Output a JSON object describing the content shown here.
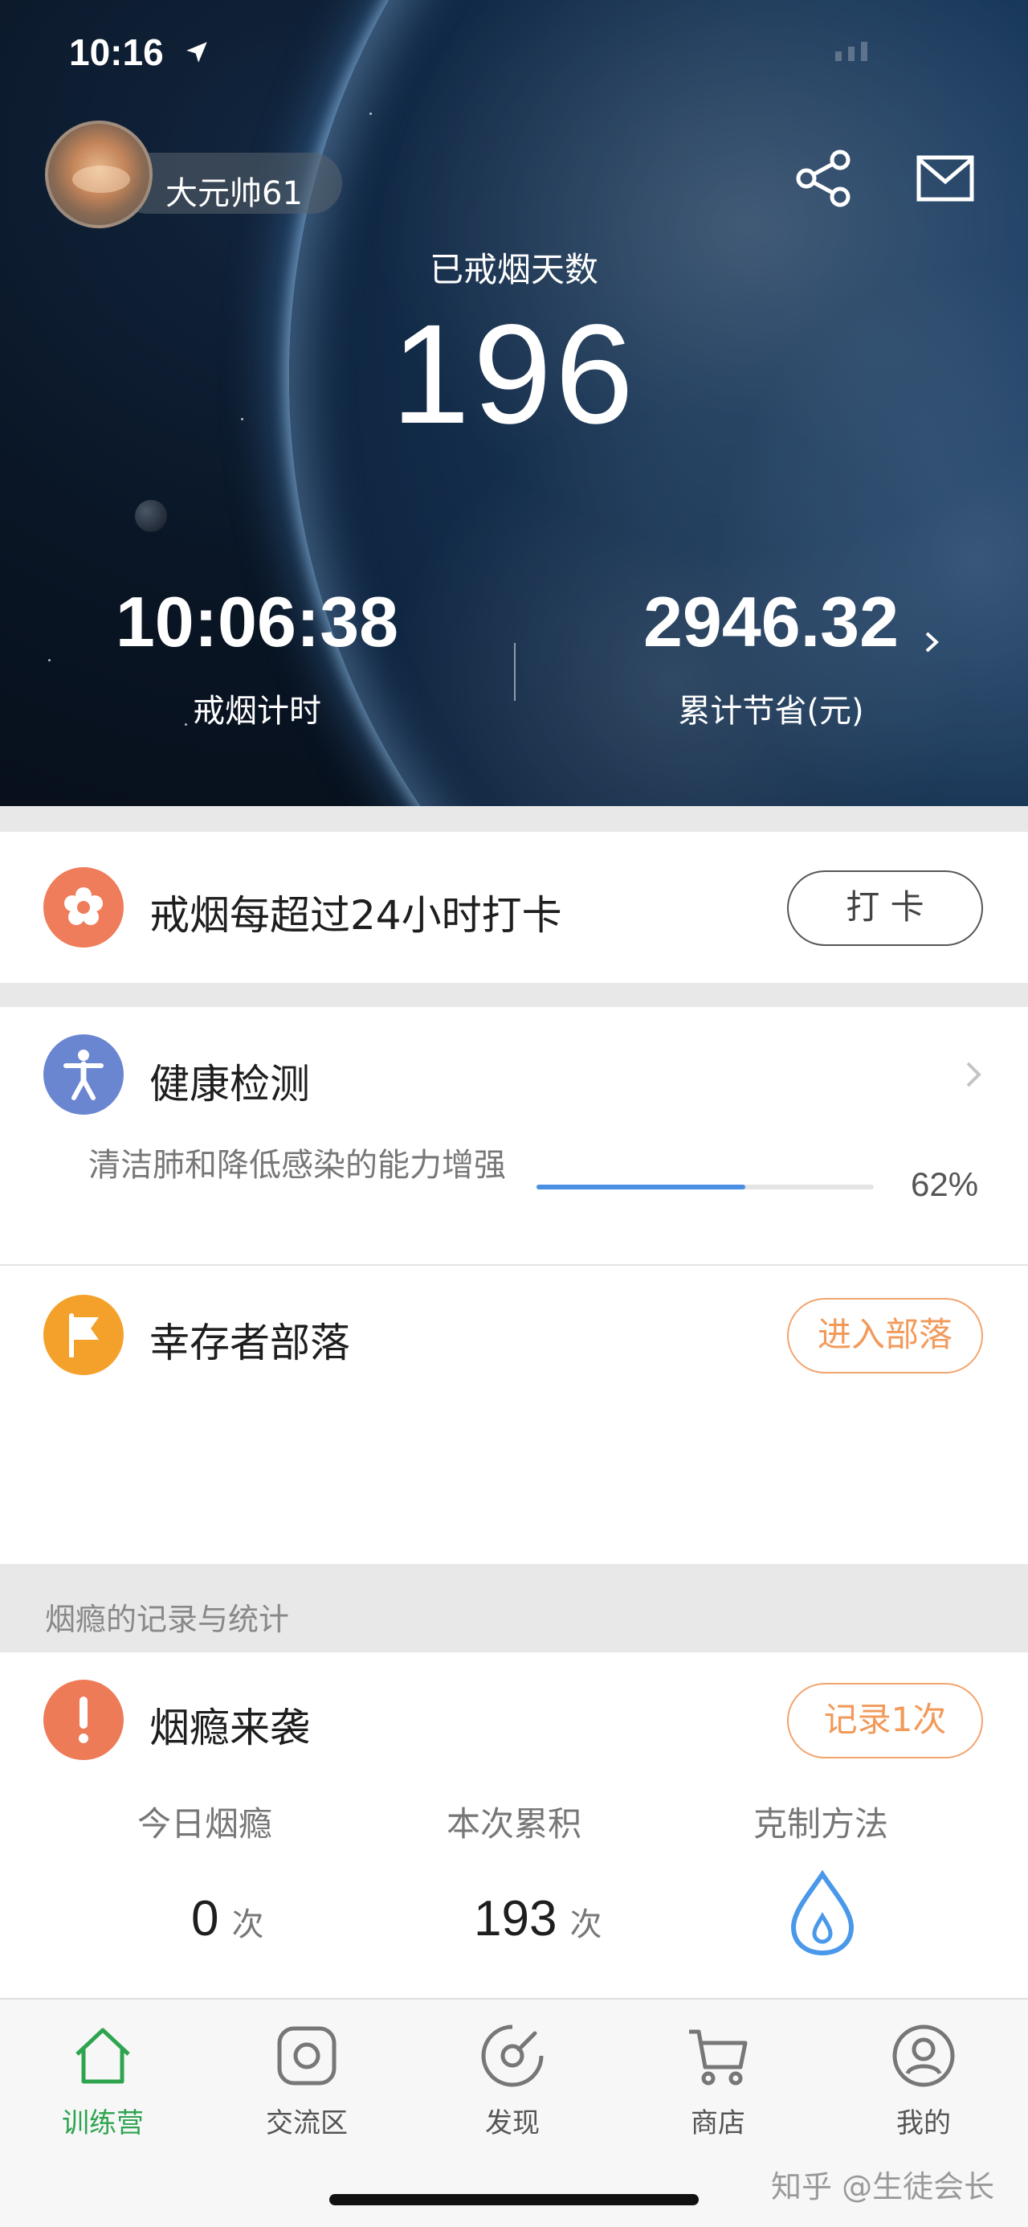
{
  "status_bar": {
    "time": "10:16"
  },
  "profile": {
    "username": "大元帅61"
  },
  "hero": {
    "quit_days_label": "已戒烟天数",
    "quit_days_value": "196",
    "timer_value": "10:06:38",
    "timer_label": "戒烟计时",
    "saved_value": "2946.32",
    "saved_label": "累计节省(元)"
  },
  "checkin": {
    "title": "戒烟每超过24小时打卡",
    "button_label": "打 卡",
    "icon": "flower-icon",
    "color": "#ef7c5a"
  },
  "health": {
    "title": "健康检测",
    "icon": "person-icon",
    "color": "#6b86d1",
    "description": "清洁肺和降低感染的能力增强",
    "progress_percent": 62,
    "progress_text": "62%"
  },
  "tribe": {
    "title": "幸存者部落",
    "button_label": "进入部落",
    "icon": "flag-icon",
    "color": "#f4a12c"
  },
  "stats_section": {
    "header": "烟瘾的记录与统计"
  },
  "craving": {
    "title": "烟瘾来袭",
    "icon": "exclamation-icon",
    "color": "#ee7b58",
    "button_label": "记录1次",
    "columns": {
      "today_label": "今日烟瘾",
      "today_value": "0",
      "today_unit": "次",
      "cumulative_label": "本次累积",
      "cumulative_value": "193",
      "cumulative_unit": "次",
      "method_label": "克制方法"
    }
  },
  "tabbar": {
    "items": [
      {
        "label": "训练营",
        "icon": "house-icon",
        "active": true
      },
      {
        "label": "交流区",
        "icon": "chat-square-icon",
        "active": false
      },
      {
        "label": "发现",
        "icon": "compass-icon",
        "active": false
      },
      {
        "label": "商店",
        "icon": "cart-icon",
        "active": false
      },
      {
        "label": "我的",
        "icon": "user-circle-icon",
        "active": false
      }
    ],
    "active_color": "#2ea44f"
  },
  "watermark": "知乎 @生徒会长"
}
